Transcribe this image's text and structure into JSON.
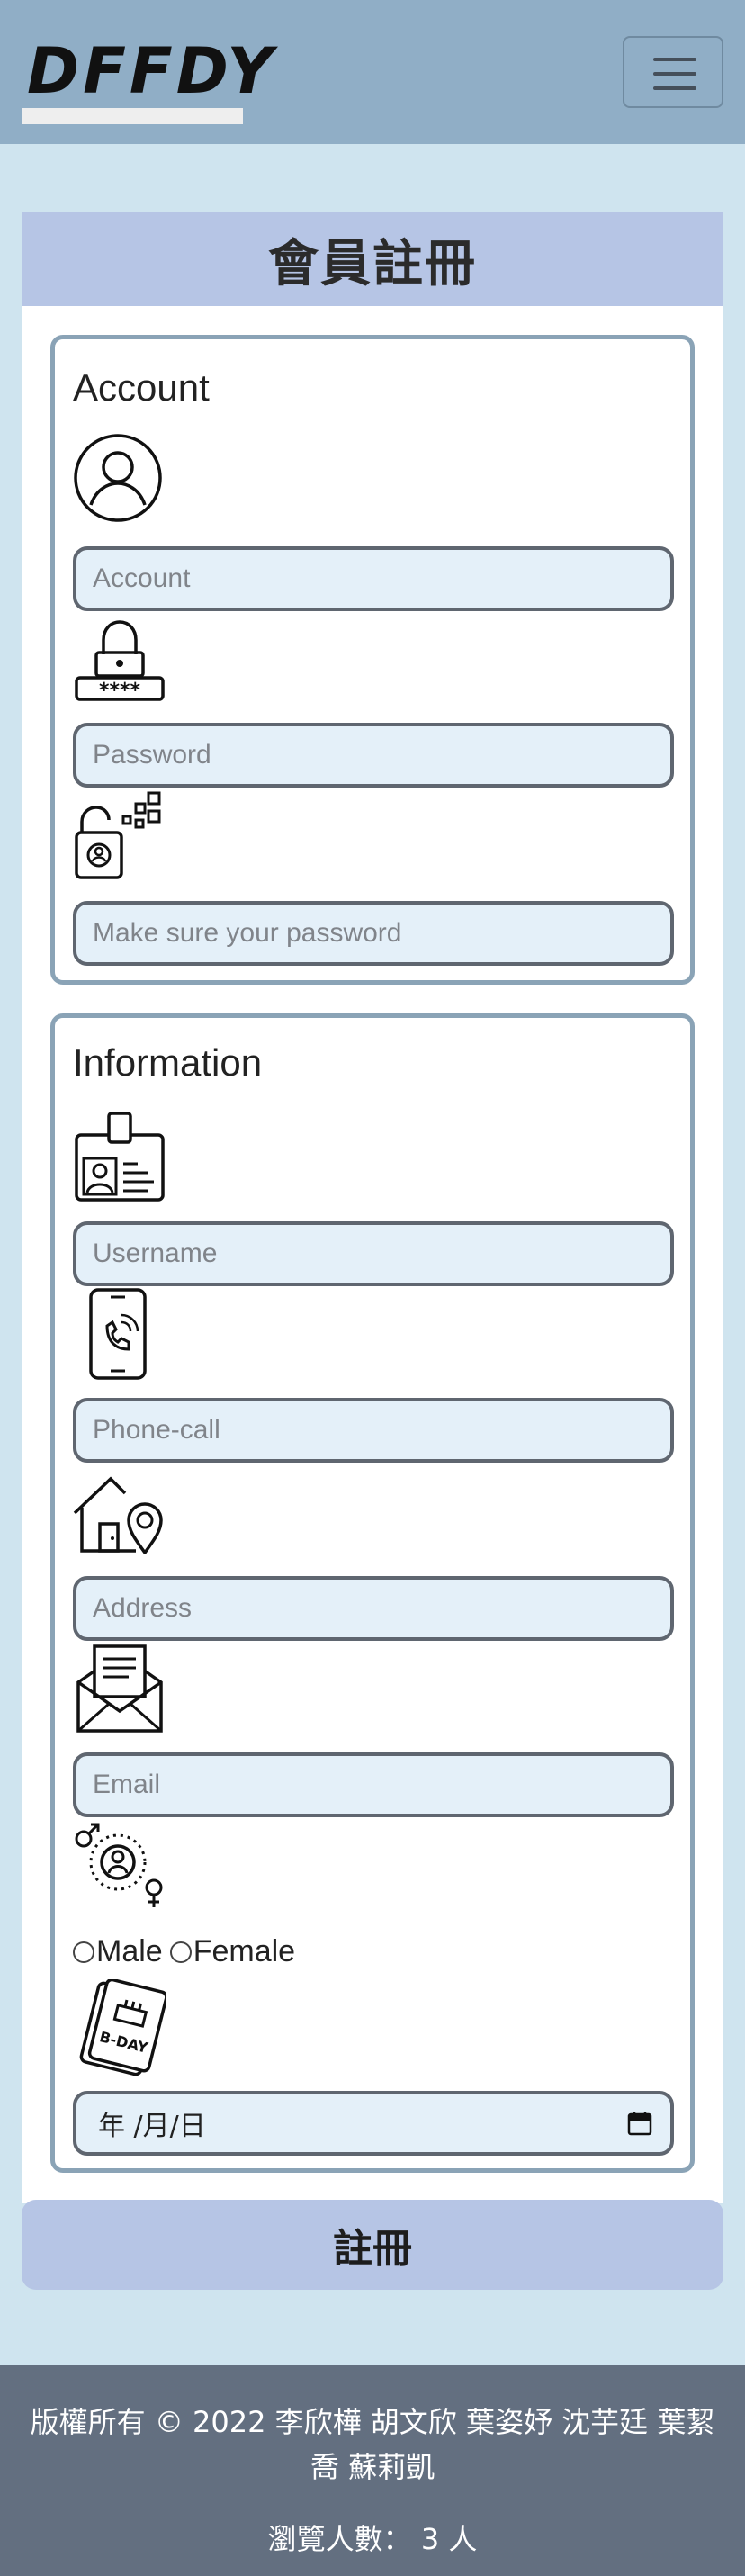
{
  "navbar": {
    "logo_text": "DFFDY",
    "menu_icon": "hamburger-menu-icon"
  },
  "form": {
    "title": "會員註冊",
    "account_section": {
      "title": "Account",
      "fields": {
        "account": {
          "icon": "user-avatar-icon",
          "placeholder": "Account"
        },
        "password": {
          "icon": "padlock-password-icon",
          "placeholder": "Password"
        },
        "confirm_password": {
          "icon": "unlock-key-icon",
          "placeholder": "Make sure your password"
        }
      }
    },
    "info_section": {
      "title": "Information",
      "fields": {
        "username": {
          "icon": "id-card-icon",
          "placeholder": "Username"
        },
        "phone": {
          "icon": "phone-call-icon",
          "placeholder": "Phone-call"
        },
        "address": {
          "icon": "home-location-icon",
          "placeholder": "Address"
        },
        "email": {
          "icon": "mail-envelope-icon",
          "placeholder": "Email"
        },
        "gender": {
          "icon": "gender-icon",
          "options": [
            "Male",
            "Female"
          ]
        },
        "birthday": {
          "icon": "birthday-card-icon",
          "icon_text": "B-DAY",
          "value": "年 /月/日"
        }
      }
    },
    "submit_label": "註冊"
  },
  "footer": {
    "copyright": "版權所有 © 2022 李欣樺 胡文欣 葉姿妤 沈芋廷 葉絜喬 蘇莉凱",
    "visits": "瀏覽人數： 3 人"
  }
}
